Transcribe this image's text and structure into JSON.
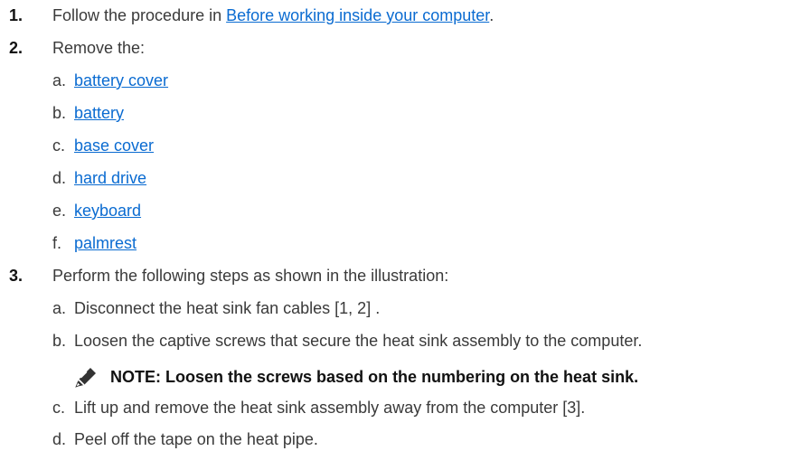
{
  "steps": [
    {
      "num": "1.",
      "pre": "Follow the procedure in ",
      "link": "Before working inside your computer",
      "post": "."
    },
    {
      "num": "2.",
      "text": "Remove the:",
      "items": [
        {
          "letter": "a.",
          "link": "battery cover"
        },
        {
          "letter": "b.",
          "link": "battery"
        },
        {
          "letter": "c.",
          "link": "base cover"
        },
        {
          "letter": "d.",
          "link": "hard drive"
        },
        {
          "letter": "e.",
          "link": "keyboard"
        },
        {
          "letter": "f.",
          "link": "palmrest"
        }
      ]
    },
    {
      "num": "3.",
      "text": "Perform the following steps as shown in the illustration:",
      "items": [
        {
          "letter": "a.",
          "text": "Disconnect the heat sink fan cables [1, 2] ."
        },
        {
          "letter": "b.",
          "text": "Loosen the captive screws that secure the heat sink assembly to the computer."
        },
        {
          "letter": "c.",
          "text": "Lift up and remove the heat sink assembly away from the computer [3]."
        },
        {
          "letter": "d.",
          "text": "Peel off the tape on the heat pipe."
        }
      ],
      "note": {
        "icon": "pencil-note-icon",
        "text": "NOTE: Loosen the screws based on the numbering on the heat sink."
      }
    }
  ],
  "colors": {
    "link": "#0a6bd1",
    "text": "#3a3a3a"
  }
}
